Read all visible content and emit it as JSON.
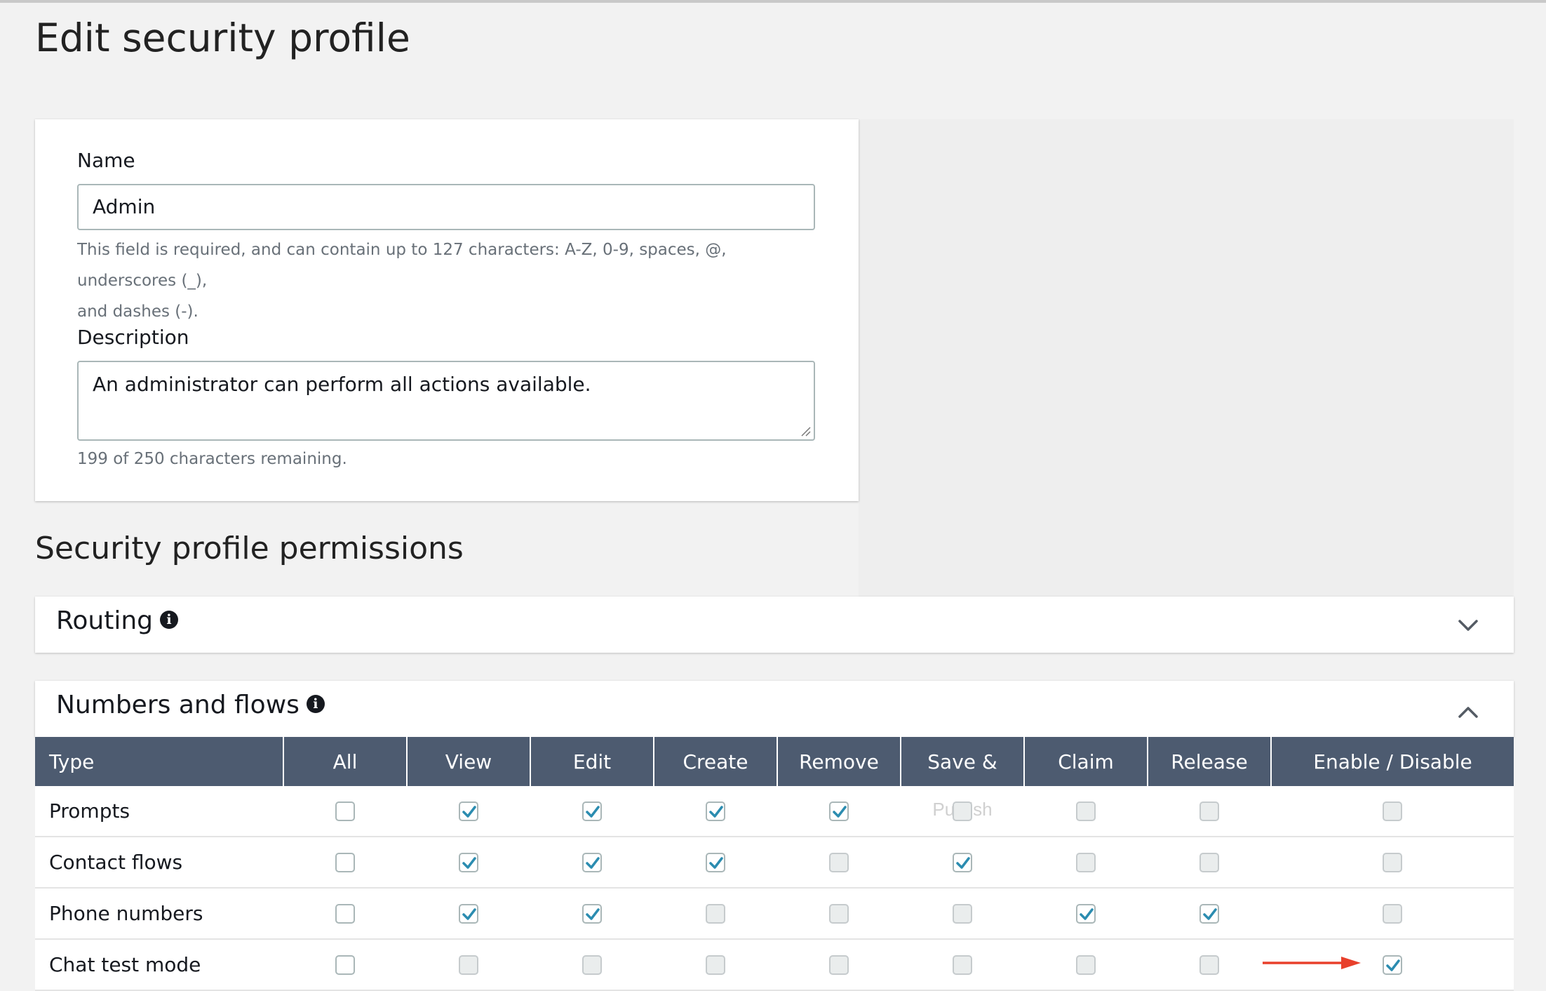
{
  "page": {
    "title": "Edit security profile"
  },
  "form": {
    "name_label": "Name",
    "name_value": "Admin",
    "name_hint_line1": "This field is required, and can contain up to 127 characters: A-Z, 0-9, spaces, @, underscores (_),",
    "name_hint_line2": "and dashes (-).",
    "description_label": "Description",
    "description_value": "An administrator can perform all actions available.",
    "description_hint": "199 of 250 characters remaining."
  },
  "permissions": {
    "title": "Security profile permissions",
    "sections": [
      {
        "title": "Routing",
        "expanded": false
      },
      {
        "title": "Numbers and flows",
        "expanded": true
      }
    ]
  },
  "table": {
    "headers": [
      "Type",
      "All",
      "View",
      "Edit",
      "Create",
      "Remove",
      "Save &",
      "Claim",
      "Release",
      "Enable / Disable"
    ],
    "save_publish_overflow": "Publish",
    "rows": [
      {
        "type": "Prompts",
        "cells": [
          "off",
          "on",
          "on",
          "on",
          "on",
          "dis",
          "dis",
          "dis",
          "dis"
        ]
      },
      {
        "type": "Contact flows",
        "cells": [
          "off",
          "on",
          "on",
          "on",
          "dis",
          "on",
          "dis",
          "dis",
          "dis"
        ]
      },
      {
        "type": "Phone numbers",
        "cells": [
          "off",
          "on",
          "on",
          "dis",
          "dis",
          "dis",
          "on",
          "on",
          "dis"
        ]
      },
      {
        "type": "Chat test mode",
        "cells": [
          "off",
          "dis",
          "dis",
          "dis",
          "dis",
          "dis",
          "dis",
          "dis",
          "on"
        ]
      }
    ]
  },
  "colors": {
    "header_bg": "#4d5b70",
    "check": "#2b8cb0",
    "annotation_arrow": "#e8402b"
  },
  "icons": {
    "info": "info-icon",
    "collapsed": "chevron-down-icon",
    "expanded": "chevron-up-icon",
    "annotation": "red-arrow-icon"
  }
}
